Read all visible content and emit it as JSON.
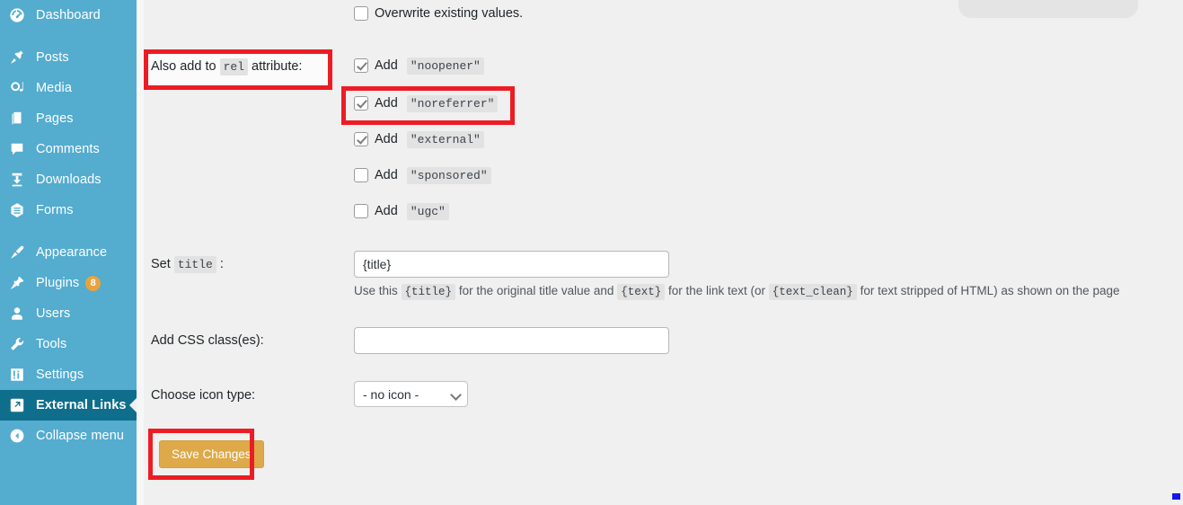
{
  "sidebar": {
    "items": [
      {
        "label": "Dashboard",
        "icon": "dashboard-icon",
        "active": false,
        "badge": null
      },
      {
        "label": "Posts",
        "icon": "pin-icon",
        "active": false,
        "badge": null
      },
      {
        "label": "Media",
        "icon": "media-icon",
        "active": false,
        "badge": null
      },
      {
        "label": "Pages",
        "icon": "pages-icon",
        "active": false,
        "badge": null
      },
      {
        "label": "Comments",
        "icon": "comment-icon",
        "active": false,
        "badge": null
      },
      {
        "label": "Downloads",
        "icon": "download-icon",
        "active": false,
        "badge": null
      },
      {
        "label": "Forms",
        "icon": "forms-icon",
        "active": false,
        "badge": null
      },
      {
        "label": "Appearance",
        "icon": "brush-icon",
        "active": false,
        "badge": null
      },
      {
        "label": "Plugins",
        "icon": "plug-icon",
        "active": false,
        "badge": "8"
      },
      {
        "label": "Users",
        "icon": "user-icon",
        "active": false,
        "badge": null
      },
      {
        "label": "Tools",
        "icon": "wrench-icon",
        "active": false,
        "badge": null
      },
      {
        "label": "Settings",
        "icon": "settings-icon",
        "active": false,
        "badge": null
      },
      {
        "label": "External Links",
        "icon": "external-link-icon",
        "active": true,
        "badge": null
      },
      {
        "label": "Collapse menu",
        "icon": "collapse-icon",
        "active": false,
        "badge": null
      }
    ]
  },
  "form": {
    "overwrite": {
      "label": "Overwrite existing values.",
      "checked": false
    },
    "rel_section": {
      "label_prefix": "Also add to",
      "label_code": "rel",
      "label_suffix": "attribute:",
      "options": [
        {
          "prefix": "Add",
          "value": "\"noopener\"",
          "checked": true
        },
        {
          "prefix": "Add",
          "value": "\"noreferrer\"",
          "checked": true
        },
        {
          "prefix": "Add",
          "value": "\"external\"",
          "checked": true
        },
        {
          "prefix": "Add",
          "value": "\"sponsored\"",
          "checked": false
        },
        {
          "prefix": "Add",
          "value": "\"ugc\"",
          "checked": false
        }
      ]
    },
    "title_row": {
      "label_prefix": "Set",
      "label_code": "title",
      "label_suffix": ":",
      "value": "{title}",
      "help": {
        "part1": "Use this",
        "code1": "{title}",
        "part2": "for the original title value and",
        "code2": "{text}",
        "part3": "for the link text (or",
        "code3": "{text_clean}",
        "part4": "for text stripped of HTML) as shown on the page"
      }
    },
    "css_row": {
      "label": "Add CSS class(es):",
      "value": "",
      "placeholder": ""
    },
    "icon_row": {
      "label": "Choose icon type:",
      "selected": "- no icon -",
      "options": [
        "- no icon -"
      ]
    },
    "save_label": "Save Changes"
  },
  "colors": {
    "sidebar_bg": "#54accf",
    "sidebar_active_bg": "#0f6e8c",
    "content_bg": "#f0f0f0",
    "badge_bg": "#e8a33d",
    "save_button_bg": "#dda949",
    "annotation_red": "#ed1c24"
  }
}
